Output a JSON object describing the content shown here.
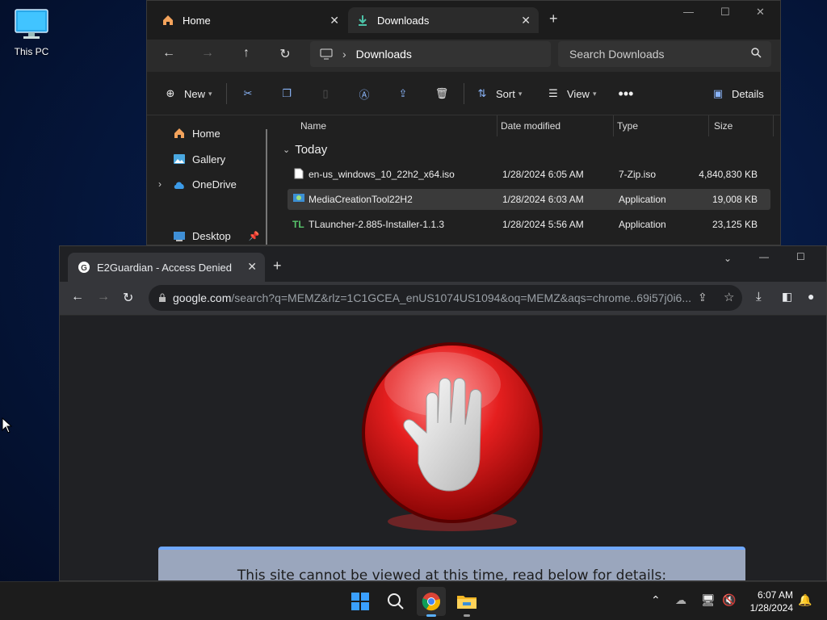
{
  "desktop": {
    "this_pc_label": "This PC"
  },
  "explorer": {
    "tabs": [
      {
        "label": "Home"
      },
      {
        "label": "Downloads"
      }
    ],
    "address": {
      "location": "Downloads"
    },
    "search_placeholder": "Search Downloads",
    "toolbar": {
      "new_label": "New",
      "sort_label": "Sort",
      "view_label": "View",
      "details_label": "Details"
    },
    "sidebar": [
      {
        "label": "Home"
      },
      {
        "label": "Gallery"
      },
      {
        "label": "OneDrive"
      },
      {
        "label": "Desktop"
      }
    ],
    "columns": {
      "name": "Name",
      "date": "Date modified",
      "type": "Type",
      "size": "Size"
    },
    "group_label": "Today",
    "files": [
      {
        "name": "en-us_windows_10_22h2_x64.iso",
        "date": "1/28/2024 6:05 AM",
        "type": "7-Zip.iso",
        "size": "4,840,830 KB"
      },
      {
        "name": "MediaCreationTool22H2",
        "date": "1/28/2024 6:03 AM",
        "type": "Application",
        "size": "19,008 KB"
      },
      {
        "name": "TLauncher-2.885-Installer-1.1.3",
        "date": "1/28/2024 5:56 AM",
        "type": "Application",
        "size": "23,125 KB"
      }
    ]
  },
  "browser": {
    "tab_title": "E2Guardian - Access Denied",
    "url_host": "google.com",
    "url_path": "/search?q=MEMZ&rlz=1C1GCEA_enUS1074US1094&oq=MEMZ&aqs=chrome..69i57j0i6...",
    "message": "This site cannot be viewed at this time, read below for details:"
  },
  "taskbar": {
    "time": "6:07 AM",
    "date": "1/28/2024"
  },
  "colors": {
    "accent": "#0078d4",
    "stop_red": "#d91c1c",
    "explorer_bg": "#202020",
    "browser_bg": "#202124"
  }
}
